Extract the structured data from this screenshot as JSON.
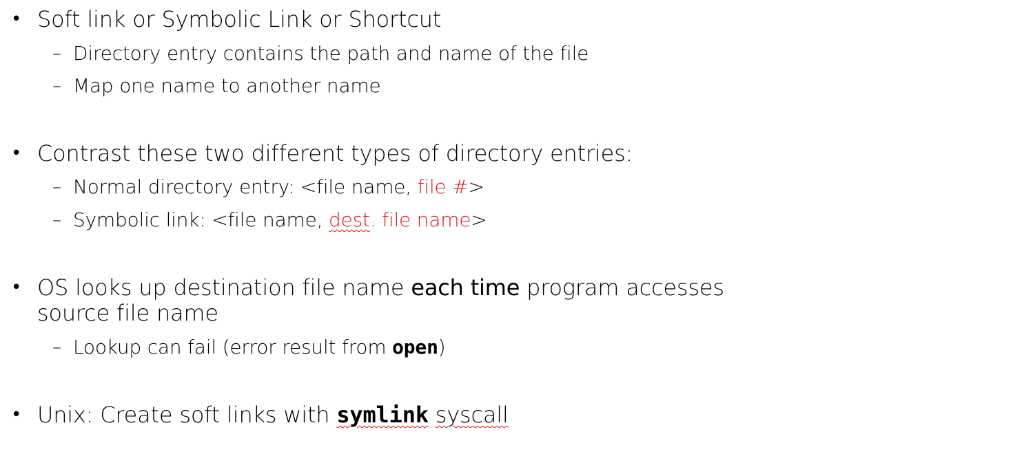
{
  "bullets": [
    {
      "text": "Soft link or Symbolic Link or Shortcut",
      "subs": [
        "Directory entry contains the path and name of the file",
        "Map one name to another name"
      ]
    },
    {
      "text": "Contrast these two different types of directory entries:",
      "subs": [
        {
          "prefix": "Normal directory entry: <file name, ",
          "red": "file #",
          "suffix": ">"
        },
        {
          "prefix": "Symbolic link: <file name, ",
          "red_underlined": "dest",
          "red": ". file name",
          "suffix": ">"
        }
      ]
    },
    {
      "line1_prefix": "OS looks up destination file name ",
      "line1_emph": "each time",
      "line1_suffix": " program accesses",
      "line2": "source file name",
      "subs": [
        {
          "prefix": "Lookup can fail (error result from ",
          "code": "open",
          "suffix": ")"
        }
      ]
    },
    {
      "prefix": "Unix: Create soft links with ",
      "code": "symlink",
      "suffix_underlined": "syscall"
    }
  ],
  "markers": {
    "bullet": "•",
    "dash": "–"
  },
  "colors": {
    "text": "#000000",
    "highlight": "#e6121b"
  }
}
